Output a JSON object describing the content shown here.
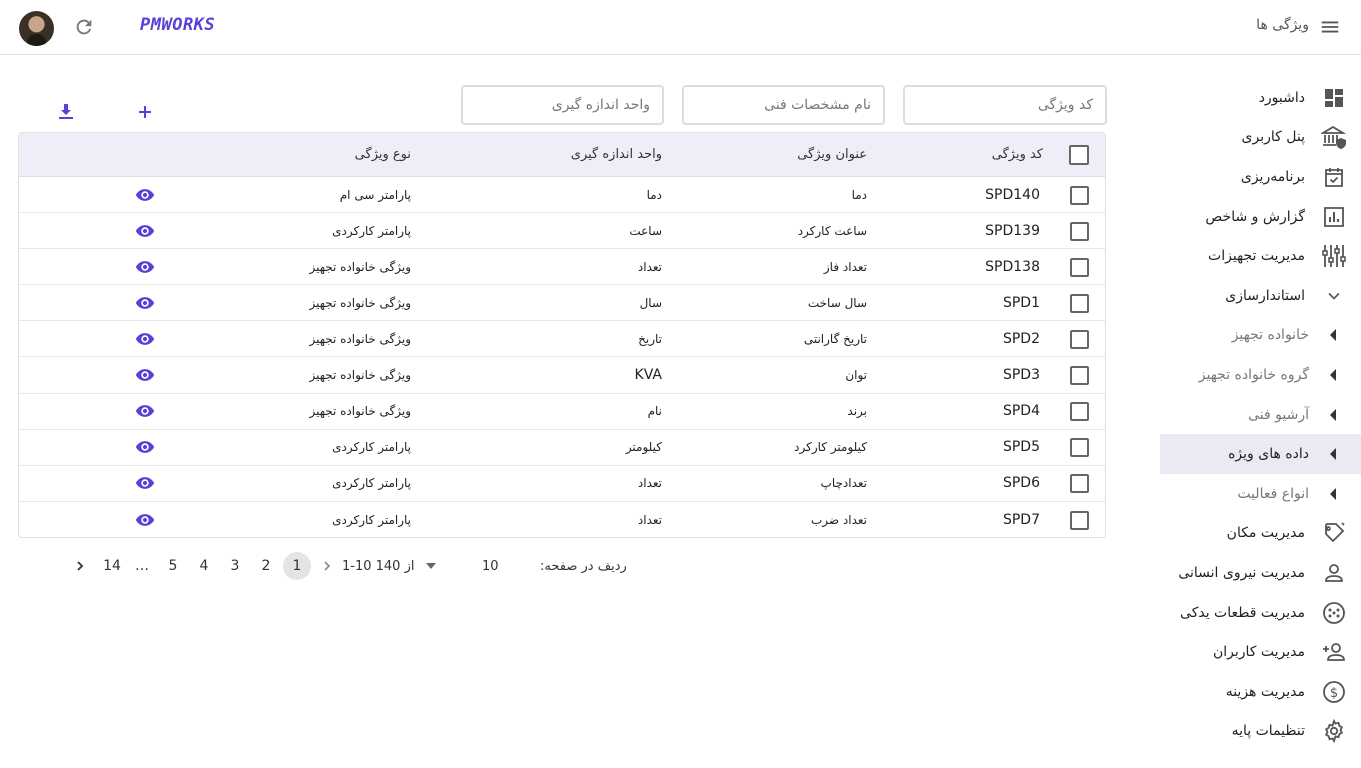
{
  "header": {
    "logo": "PMWORKS",
    "page_title": "ویژگی ها"
  },
  "sidebar": {
    "items": [
      {
        "label": "داشبورد",
        "icon": "dashboard-icon"
      },
      {
        "label": "پنل کاربری",
        "icon": "bank-shield-icon"
      },
      {
        "label": "برنامه‌ریزی",
        "icon": "calendar-check-icon"
      },
      {
        "label": "گزارش و شاخص",
        "icon": "bar-chart-icon"
      },
      {
        "label": "مدیریت تجهیزات",
        "icon": "equalizer-icon"
      },
      {
        "label": "استاندارسازی",
        "icon": "chevron-down-icon"
      },
      {
        "label": "خانواده تجهیز",
        "icon": "caret-left-icon"
      },
      {
        "label": "گروه خانواده تجهیز",
        "icon": "caret-left-icon"
      },
      {
        "label": "آرشیو فنی",
        "icon": "caret-left-icon"
      },
      {
        "label": "داده های ویژه",
        "icon": "caret-left-icon"
      },
      {
        "label": "انواع فعالیت",
        "icon": "caret-left-icon"
      },
      {
        "label": "مدیریت مکان",
        "icon": "location-tag-icon"
      },
      {
        "label": "مدیریت نیروی انسانی",
        "icon": "person-icon"
      },
      {
        "label": "مدیریت قطعات یدکی",
        "icon": "parts-icon"
      },
      {
        "label": "مدیریت کاربران",
        "icon": "person-add-icon"
      },
      {
        "label": "مدیریت هزینه",
        "icon": "dollar-icon"
      },
      {
        "label": "تنظیمات پایه",
        "icon": "gear-icon"
      }
    ]
  },
  "filters": {
    "code_placeholder": "کد ویژگی",
    "name_placeholder": "نام مشخصات فنی",
    "unit_placeholder": "واحد اندازه گیری"
  },
  "table": {
    "headers": {
      "code": "کد ویژگی",
      "title": "عنوان ویژگی",
      "unit": "واحد اندازه گیری",
      "type": "نوع ویژگی"
    },
    "rows": [
      {
        "code": "SPD140",
        "title": "دما",
        "unit": "دما",
        "type": "پارامتر سی ام"
      },
      {
        "code": "SPD139",
        "title": "ساعت کارکرد",
        "unit": "ساعت",
        "type": "پارامتر کارکردی"
      },
      {
        "code": "SPD138",
        "title": "تعداد فاز",
        "unit": "تعداد",
        "type": "ویژگی خانواده تجهیز"
      },
      {
        "code": "SPD1",
        "title": "سال ساخت",
        "unit": "سال",
        "type": "ویژگی خانواده تجهیز"
      },
      {
        "code": "SPD2",
        "title": "تاریخ گارانتی",
        "unit": "تاریخ",
        "type": "ویژگی خانواده تجهیز"
      },
      {
        "code": "SPD3",
        "title": "توان",
        "unit": "KVA",
        "type": "ویژگی خانواده تجهیز"
      },
      {
        "code": "SPD4",
        "title": "برند",
        "unit": "نام",
        "type": "ویژگی خانواده تجهیز"
      },
      {
        "code": "SPD5",
        "title": "کیلومتر کارکرد",
        "unit": "کیلومتر",
        "type": "پارامتر کارکردی"
      },
      {
        "code": "SPD6",
        "title": "تعدادچاپ",
        "unit": "تعداد",
        "type": "پارامتر کارکردی"
      },
      {
        "code": "SPD7",
        "title": "تعداد ضرب",
        "unit": "تعداد",
        "type": "پارامتر کارکردی"
      }
    ]
  },
  "pagination": {
    "rows_per_page_label": "ردیف در صفحه:",
    "rows_per_page": "10",
    "range": "1-10 از 140",
    "pages": [
      "1",
      "2",
      "3",
      "4",
      "5",
      "…",
      "14"
    ],
    "current_page": "1"
  },
  "colors": {
    "accent": "#5b3fd6",
    "header_bg": "#efeef8",
    "active_item_bg": "#ebeaf4"
  }
}
